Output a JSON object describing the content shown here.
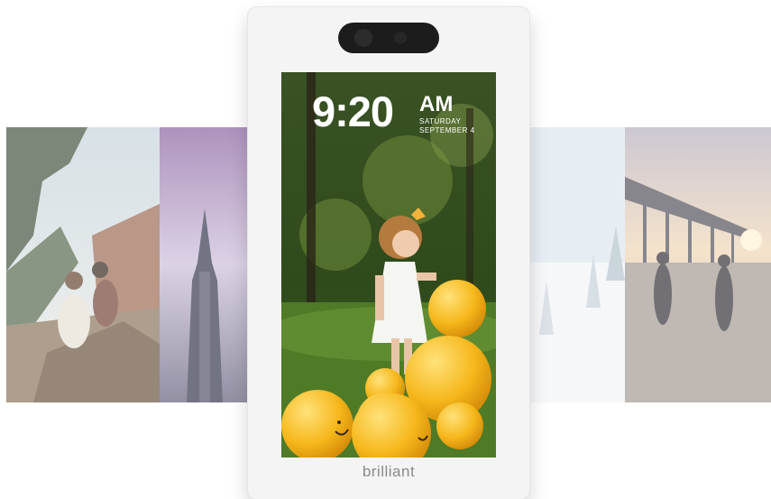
{
  "clock": {
    "time": "9:20",
    "ampm": "AM",
    "day": "SATURDAY",
    "date": "SEPTEMBER 4"
  },
  "brand": "brilliant",
  "photos": [
    "hikers",
    "tower",
    "snow-trees",
    "pier-sunset",
    "girl-with-balloons"
  ]
}
